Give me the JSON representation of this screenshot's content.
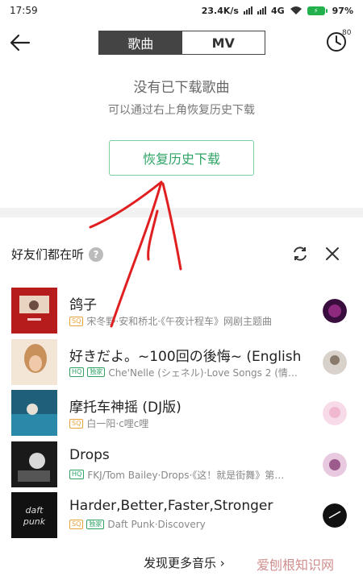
{
  "status_bar": {
    "time": "17:59",
    "speed": "23.4K/s",
    "network": "4G",
    "battery": "97%"
  },
  "header": {
    "tab_songs": "歌曲",
    "tab_mv": "MV",
    "timer_badge": "80"
  },
  "empty_state": {
    "title": "没有已下载歌曲",
    "subtitle": "可以通过右上角恢复历史下载",
    "restore_button": "恢复历史下载"
  },
  "friends": {
    "title": "好友们都在听",
    "help": "?",
    "songs": [
      {
        "title": "鸽子",
        "meta": "宋冬野·安和桥北·《午夜计程车》网剧主题曲",
        "badges": [
          "SQ"
        ]
      },
      {
        "title": "好きだよ。~100回の後悔~ (English",
        "meta": "Che'Nelle (シェネル)·Love Songs 2 (情…",
        "badges": [
          "HQ",
          "独家"
        ]
      },
      {
        "title": "摩托车神摇 (DJ版)",
        "meta": "白一阳·c哩c哩",
        "badges": [
          "SQ"
        ]
      },
      {
        "title": "Drops",
        "meta": "FKJ/Tom Bailey·Drops·《这！就是街舞》第…",
        "badges": [
          "HQ"
        ]
      },
      {
        "title": "Harder,Better,Faster,Stronger",
        "meta": "Daft Punk·Discovery",
        "badges": [
          "SQ",
          "独家"
        ]
      }
    ]
  },
  "footer": {
    "discover": "发现更多音乐 ›",
    "watermark": "爱刨根知识网"
  },
  "colors": {
    "accent_green": "#2fa465",
    "sq_orange": "#e8a33a",
    "annotation_red": "#e02020"
  }
}
